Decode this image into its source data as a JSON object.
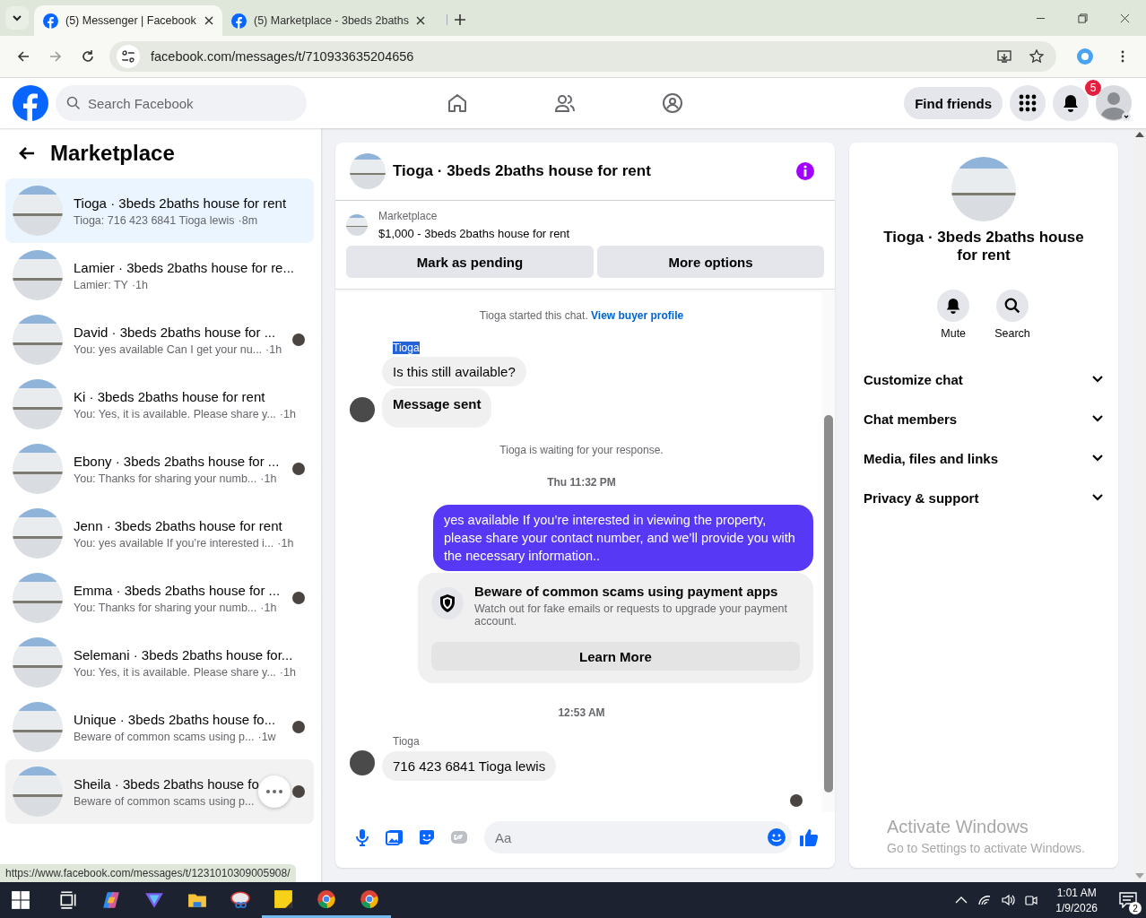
{
  "browser": {
    "tabs": [
      {
        "title": "(5) Messenger | Facebook",
        "selected": true
      },
      {
        "title": "(5) Marketplace - 3beds 2baths",
        "selected": false
      }
    ],
    "url": "facebook.com/messages/t/710933635204656"
  },
  "header": {
    "search_placeholder": "Search Facebook",
    "nav": [
      {
        "kind": "home"
      },
      {
        "kind": "friends"
      },
      {
        "kind": "groups"
      }
    ],
    "find_friends": "Find friends",
    "notification_count": "5"
  },
  "sidebar": {
    "title": "Marketplace",
    "conversations": [
      {
        "title": "Tioga · 3beds 2baths house for rent",
        "preview": "Tioga: 716 423 6841 Tioga lewis",
        "time": "·8m",
        "selected": true,
        "hovered": false,
        "seen_avatar": false
      },
      {
        "title": "Lamier · 3beds 2baths house for re...",
        "preview": "Lamier: TY",
        "time": "·1h",
        "selected": false,
        "hovered": false,
        "seen_avatar": false
      },
      {
        "title": "David · 3beds 2baths house for ...",
        "preview": "You: yes available Can I get your nu...",
        "time": "·1h",
        "selected": false,
        "hovered": false,
        "seen_avatar": true
      },
      {
        "title": "Ki · 3beds 2baths house for rent",
        "preview": "You: Yes, it is available. Please share y...",
        "time": "·1h",
        "selected": false,
        "hovered": false,
        "seen_avatar": false
      },
      {
        "title": "Ebony · 3beds 2baths house for ...",
        "preview": "You: Thanks for sharing your numb...",
        "time": "·1h",
        "selected": false,
        "hovered": false,
        "seen_avatar": true
      },
      {
        "title": "Jenn · 3beds 2baths house for rent",
        "preview": "You: yes available If you’re interested i...",
        "time": "·1h",
        "selected": false,
        "hovered": false,
        "seen_avatar": false
      },
      {
        "title": "Emma · 3beds 2baths house for ...",
        "preview": "You: Thanks for sharing your numb...",
        "time": "·1h",
        "selected": false,
        "hovered": false,
        "seen_avatar": true
      },
      {
        "title": "Selemani · 3beds 2baths house for...",
        "preview": "You: Yes, it is available. Please share y...",
        "time": "·1h",
        "selected": false,
        "hovered": false,
        "seen_avatar": false
      },
      {
        "title": "Unique · 3beds 2baths house fo...",
        "preview": "Beware of common scams using p...",
        "time": "·1w",
        "selected": false,
        "hovered": false,
        "seen_avatar": true
      },
      {
        "title": "Sheila · 3beds 2baths house fo",
        "preview": "Beware of common scams using p...",
        "selected": false,
        "hovered": true,
        "seen_avatar": true
      }
    ]
  },
  "chat": {
    "title": "Tioga · 3beds 2baths house for rent",
    "listing": {
      "label": "Marketplace",
      "price_title": "$1,000 - 3beds 2baths house for rent",
      "buttons": [
        "Mark as pending",
        "More options"
      ]
    },
    "messages": [
      {
        "kind": "notice",
        "text": "Tioga started this chat.",
        "link": "View buyer profile"
      },
      {
        "kind": "incoming",
        "sender": "Tioga",
        "sender_selected": true,
        "bubbles": [
          {
            "text": "Is this still available?",
            "emphasis": false
          },
          {
            "text": "Message sent",
            "emphasis": true
          }
        ]
      },
      {
        "kind": "notice",
        "text": "Tioga is waiting for your response."
      },
      {
        "kind": "time",
        "text": "Thu 11:32 PM"
      },
      {
        "kind": "outgoing",
        "text": "yes available  If you’re interested in viewing the property, please share your contact number, and we’ll provide you with the necessary information.."
      },
      {
        "kind": "alert",
        "title": "Beware of common scams using payment apps",
        "body": "Watch out for fake emails or requests to upgrade your payment account.",
        "button": "Learn More"
      },
      {
        "kind": "time",
        "text": "12:53 AM"
      },
      {
        "kind": "incoming",
        "sender": "Tioga",
        "sender_selected": false,
        "bubbles": [
          {
            "text": "716 423 6841 Tioga lewis",
            "emphasis": false
          }
        ]
      }
    ],
    "seen": true,
    "composer_placeholder": "Aa"
  },
  "details": {
    "title": "Tioga · 3beds 2baths house for rent",
    "actions": [
      {
        "kind": "mute",
        "label": "Mute"
      },
      {
        "kind": "search",
        "label": "Search"
      }
    ],
    "sections": [
      {
        "label": "Customize chat",
        "expanded": false
      },
      {
        "label": "Chat members",
        "expanded": false
      },
      {
        "label": "Media, files and links",
        "expanded": false
      },
      {
        "label": "Privacy & support",
        "expanded": false
      }
    ]
  },
  "activation": {
    "title": "Activate Windows",
    "hint": "Go to Settings to activate Windows."
  },
  "status_url": "https://www.facebook.com/messages/t/1231010309005908/",
  "taskbar": {
    "apps": [
      {
        "kind": "taskview",
        "running": false
      },
      {
        "kind": "copilot",
        "running": false
      },
      {
        "kind": "vpn",
        "running": false
      },
      {
        "kind": "files",
        "running": false
      },
      {
        "kind": "snip",
        "running": false
      },
      {
        "kind": "notes",
        "running": true
      },
      {
        "kind": "chrome",
        "running": true
      },
      {
        "kind": "chrome2",
        "running": true
      }
    ],
    "time": "1:01 AM",
    "date": "1/9/2026",
    "notifications": "2"
  }
}
